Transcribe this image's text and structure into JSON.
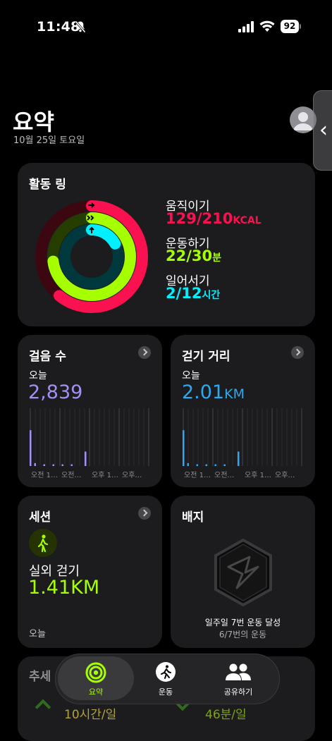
{
  "status": {
    "time": "11:48",
    "battery": "92"
  },
  "header": {
    "title": "요약",
    "date": "10월 25일 토요일"
  },
  "activity": {
    "title": "활동 링",
    "move": {
      "label": "움직이기",
      "value": "129/210",
      "unit": "KCAL",
      "progress": 0.61,
      "color": "#fa114f"
    },
    "exercise": {
      "label": "운동하기",
      "value": "22/30",
      "unit": "분",
      "progress": 0.73,
      "color": "#a6ff00"
    },
    "stand": {
      "label": "일어서기",
      "value": "2/12",
      "unit": "시간",
      "progress": 0.17,
      "color": "#00f0ff"
    }
  },
  "steps": {
    "title": "걸음 수",
    "sub": "오늘",
    "value": "2,839",
    "color": "#a48ff5",
    "ticks": [
      "오전 1…",
      "오전…",
      "오후 1…",
      "오후…"
    ],
    "bars": [
      0.62,
      0.05,
      0,
      0.03,
      0,
      0.03,
      0,
      0.03,
      0,
      0.03,
      0,
      0,
      0.25
    ]
  },
  "distance": {
    "title": "걷기 거리",
    "sub": "오늘",
    "value": "2.01",
    "unit": "KM",
    "color": "#2ea8f0",
    "ticks": [
      "오전 1…",
      "오전…",
      "오후 1…",
      "오후…"
    ],
    "bars": [
      0.62,
      0.05,
      0,
      0.03,
      0,
      0.03,
      0,
      0.03,
      0,
      0.03,
      0,
      0,
      0.25
    ]
  },
  "session": {
    "title": "세션",
    "activity": "실외 걷기",
    "value": "1.41KM",
    "footer": "오늘",
    "color": "#a6ff00"
  },
  "badge": {
    "title": "배지",
    "line1": "일주일 7번 운동 달성",
    "line2": "6/7번의 운동"
  },
  "trends": {
    "title": "추세",
    "left_value": "10시간/일",
    "right_value": "46분/일"
  },
  "tabs": [
    {
      "label": "요약",
      "icon": "rings-icon",
      "active": true
    },
    {
      "label": "운동",
      "icon": "running-icon",
      "active": false
    },
    {
      "label": "공유하기",
      "icon": "people-icon",
      "active": false
    }
  ]
}
